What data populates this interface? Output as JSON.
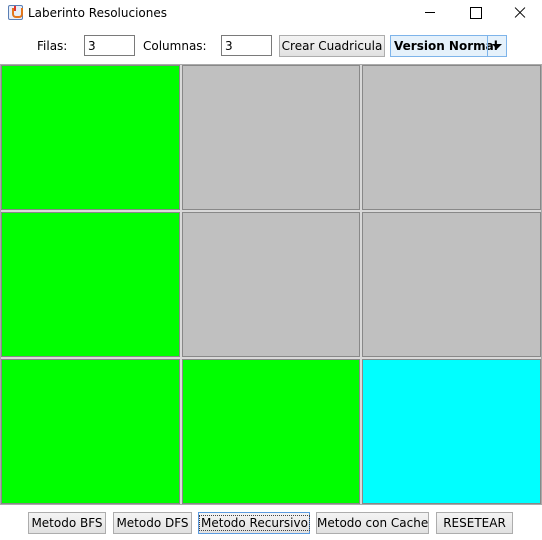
{
  "window": {
    "title": "Laberinto Resoluciones",
    "icon": "java-cup-icon"
  },
  "toolbar": {
    "filas_label": "Filas:",
    "filas_value": "3",
    "columnas_label": "Columnas:",
    "columnas_value": "3",
    "crear_button": "Crear Cuadricula",
    "version_selected": "Version Normal"
  },
  "grid": {
    "rows": 3,
    "columns": 3,
    "colors": {
      "path": "#00ff00",
      "empty": "#c0c0c0",
      "goal": "#00ffff"
    },
    "cells": [
      [
        "path",
        "empty",
        "empty"
      ],
      [
        "path",
        "empty",
        "empty"
      ],
      [
        "path",
        "path",
        "goal"
      ]
    ]
  },
  "actions": {
    "bfs": "Metodo BFS",
    "dfs": "Metodo DFS",
    "recursivo": "Metodo Recursivo",
    "cache": "Metodo con Cache",
    "reset": "RESETEAR"
  }
}
